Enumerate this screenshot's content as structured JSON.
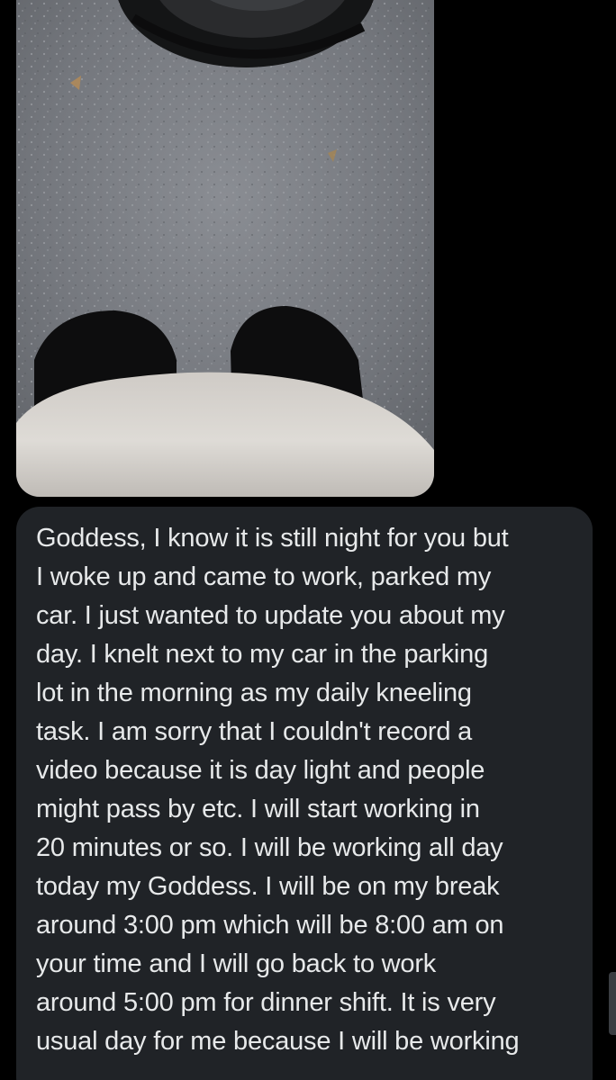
{
  "colors": {
    "background": "#000000",
    "bubble": "#202327",
    "text": "#e7e9ea"
  },
  "photo": {
    "subject": "feet-on-asphalt-next-to-car-tire"
  },
  "message": {
    "lines": [
      "Goddess, I know it is still night for you but",
      "I woke up and came to work, parked my",
      "car. I just wanted to update you about my",
      "day. I knelt next to my car in the parking",
      "lot in the morning as my daily kneeling",
      "task. I am sorry that I couldn't record a",
      "video because it is day light and people",
      "might pass by etc. I will start working in",
      "20 minutes or so. I will be working all day",
      "today my Goddess. I will be on my break",
      "around 3:00 pm which will be 8:00 am on",
      "your time and I will go back to work",
      "around 5:00 pm for dinner shift. It is very",
      "usual day for me because I will be working"
    ]
  }
}
